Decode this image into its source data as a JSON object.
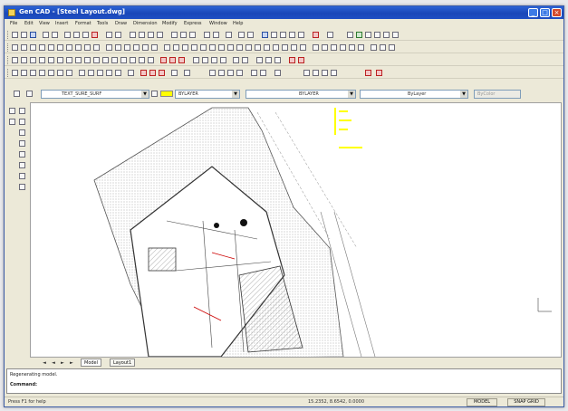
{
  "window": {
    "title": "Gen CAD - [Steel Layout.dwg]",
    "minimize_label": "_",
    "maximize_label": "□",
    "close_label": "×"
  },
  "menu": [
    "File",
    "Edit",
    "View",
    "Insert",
    "Format",
    "Tools",
    "Draw",
    "Dimension",
    "Modify",
    "Express",
    "Window",
    "Help"
  ],
  "layer_bar": {
    "layer_name": "TEXT_SURE_SURF",
    "color_name": "BYLAYER",
    "linetype": "BYLAYER",
    "lineweight": "ByLayer",
    "plotstyle": "ByColor"
  },
  "tabs": {
    "nav": [
      "◄",
      "◄",
      "►",
      "►"
    ],
    "items": [
      "Model",
      "Layout1"
    ]
  },
  "command": {
    "history": "Regenerating model.",
    "prompt": "Command:"
  },
  "status": {
    "hint": "Press F1 for help",
    "coords": "15.2352, 8.6542, 0.0000",
    "model_label": "MODEL",
    "toggle_label": "SNAP GRID"
  },
  "colors": {
    "titlebar": "#1a47b8",
    "highlight": "#ffff00",
    "accent_red": "#cc0000"
  }
}
